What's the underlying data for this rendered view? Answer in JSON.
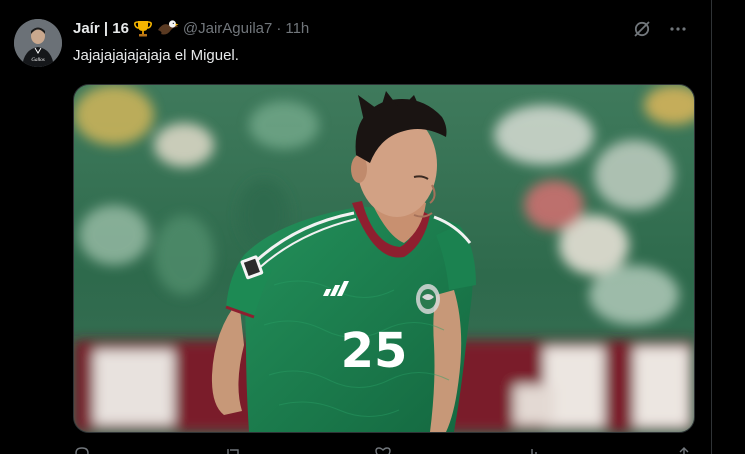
{
  "tweet": {
    "author": {
      "display_name": "Jaír | 16",
      "emojis": [
        "trophy-emoji",
        "eagle-emoji"
      ],
      "handle": "@JairAguila7",
      "separator": "·",
      "timestamp": "11h"
    },
    "text": "Jajajajajajajaja el Miguel.",
    "media": {
      "jersey_number": "25",
      "brand": "adidas"
    },
    "icons": {
      "grok": "grok-icon",
      "more": "more-icon"
    }
  },
  "colors": {
    "background": "#000000",
    "text_primary": "#e7e9ea",
    "text_secondary": "#71767b",
    "border": "#2f3336",
    "jersey_green": "#1f7a4d"
  }
}
